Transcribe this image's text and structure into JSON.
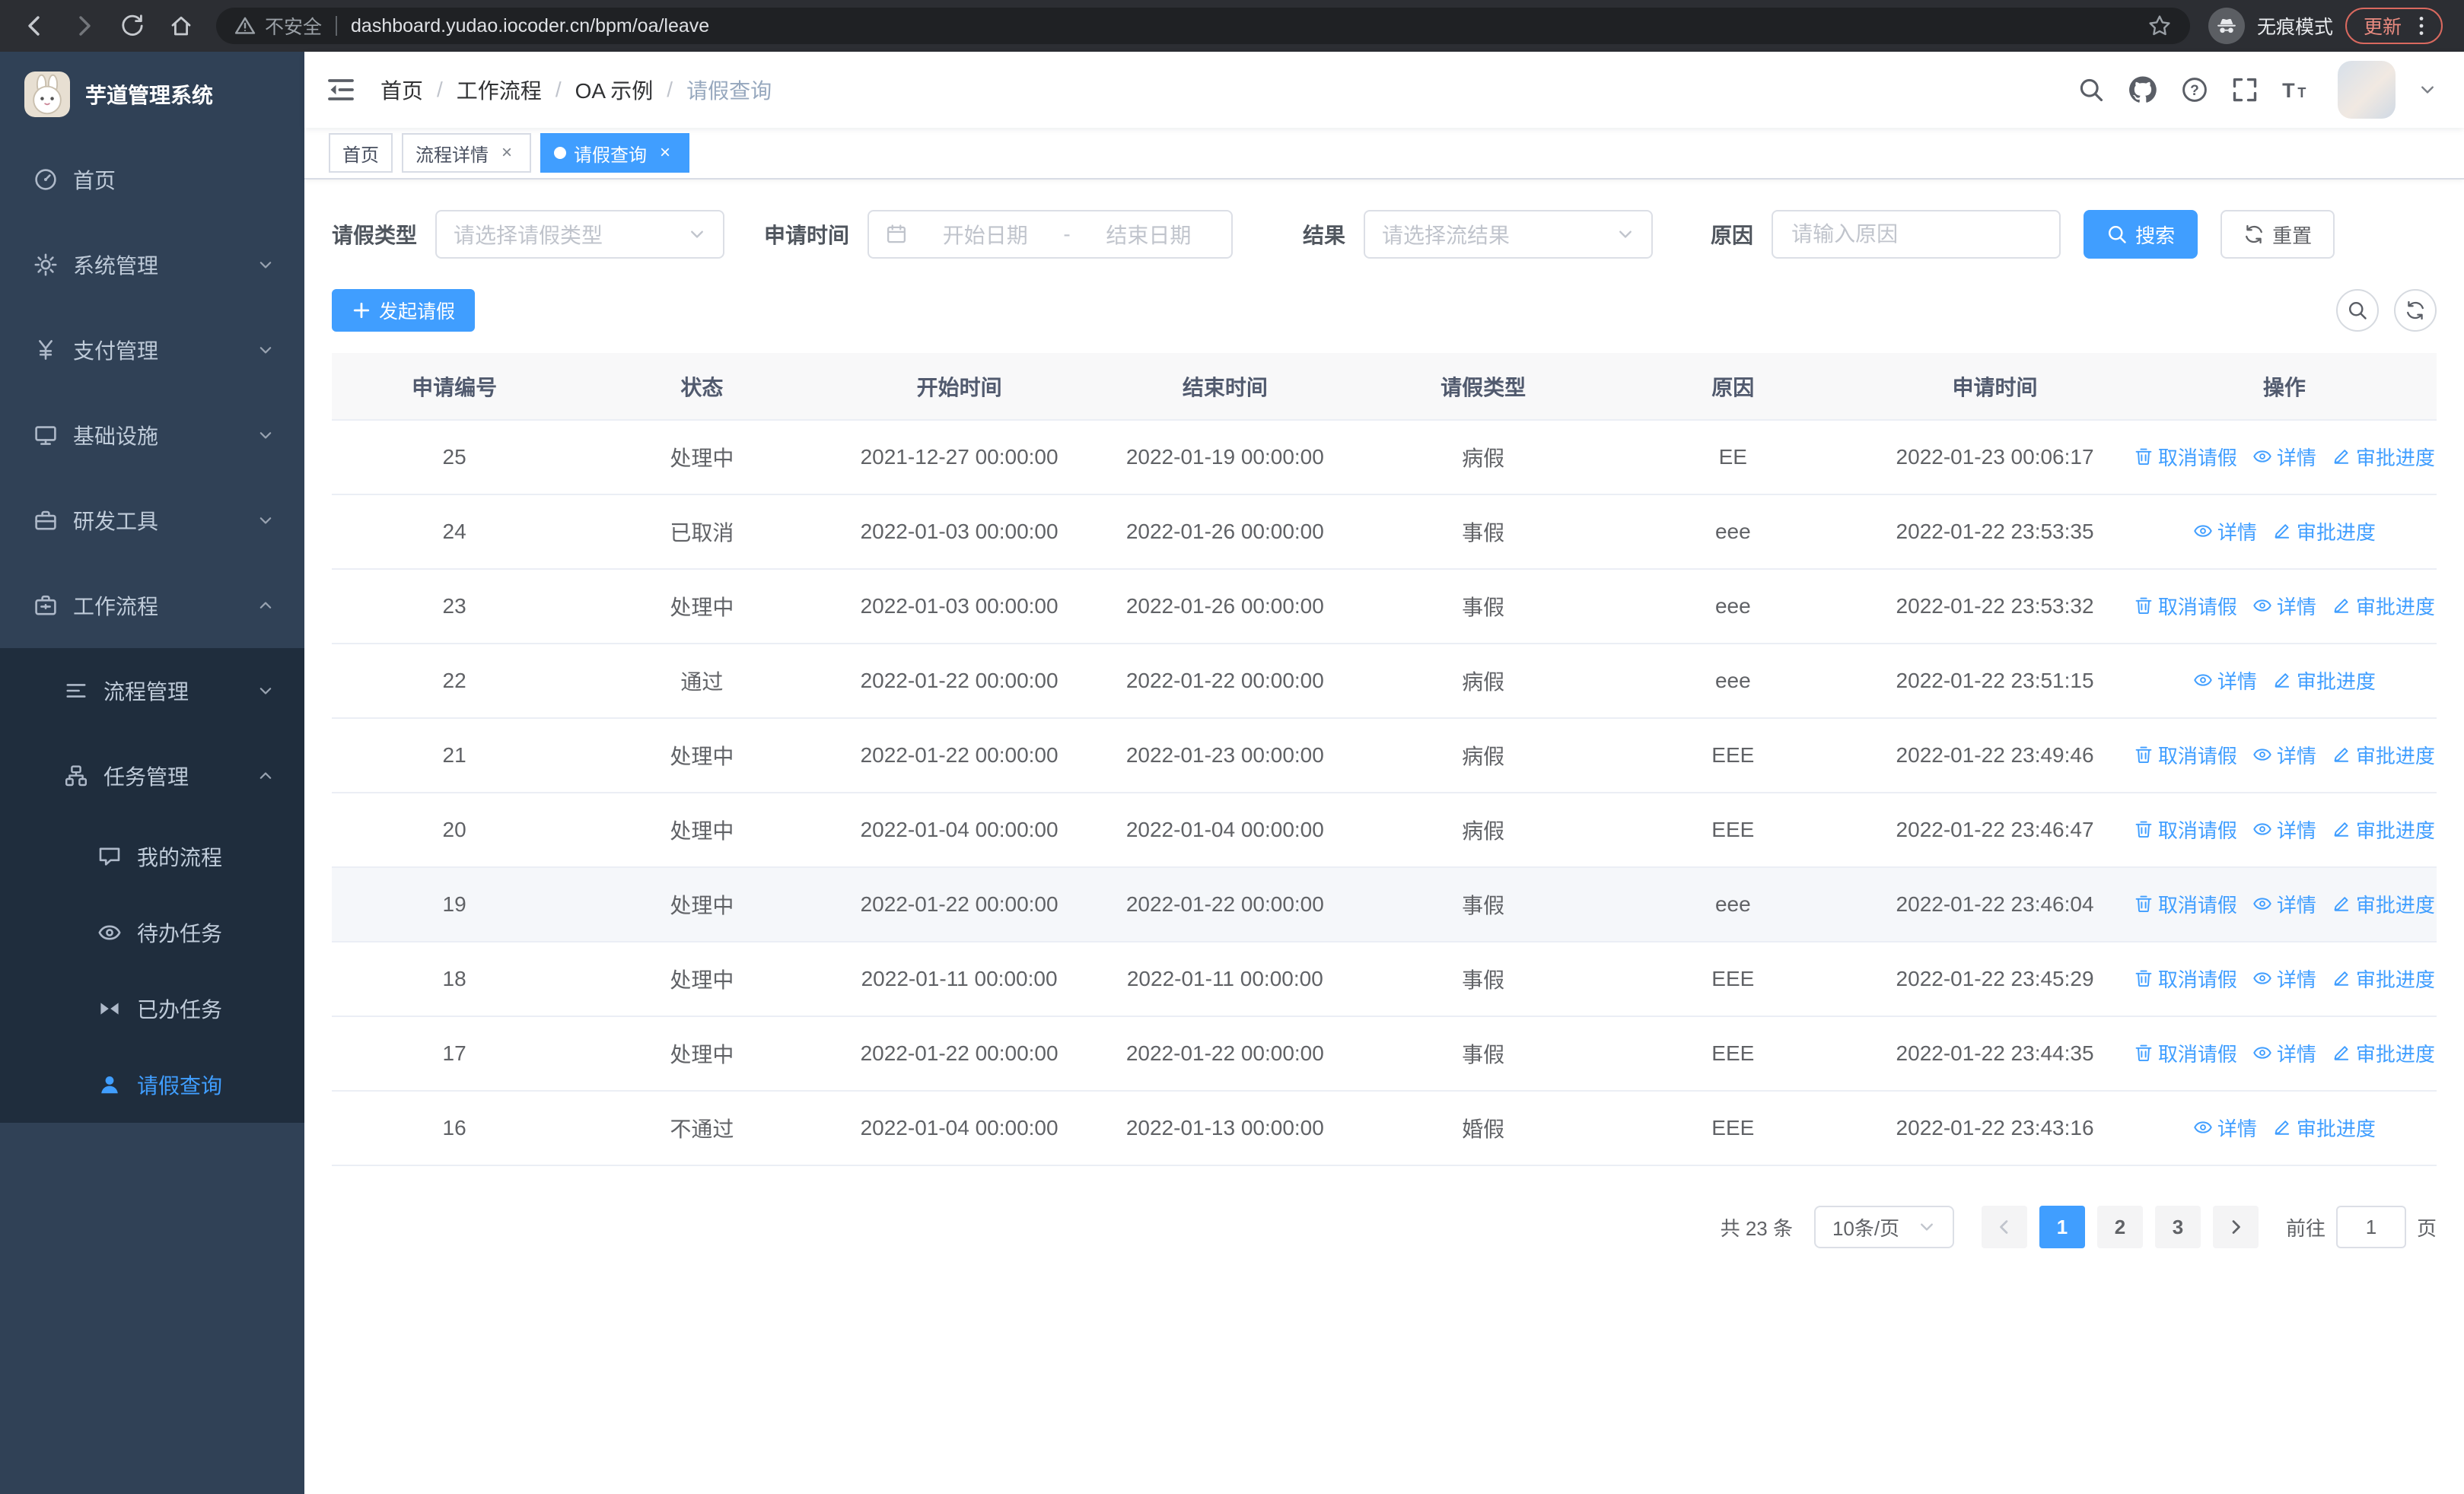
{
  "browser": {
    "security_warning": "不安全",
    "url": "dashboard.yudao.iocoder.cn/bpm/oa/leave",
    "incognito_label": "无痕模式",
    "update_label": "更新"
  },
  "sidebar": {
    "title": "芋道管理系统",
    "menu": [
      {
        "id": "home",
        "label": "首页",
        "icon": "dashboard-icon",
        "type": "top"
      },
      {
        "id": "system",
        "label": "系统管理",
        "icon": "gear-icon",
        "type": "top",
        "arrow": "down"
      },
      {
        "id": "payment",
        "label": "支付管理",
        "icon": "payment-icon",
        "type": "top",
        "arrow": "down"
      },
      {
        "id": "infrastructure",
        "label": "基础设施",
        "icon": "infra-icon",
        "type": "top",
        "arrow": "down"
      },
      {
        "id": "dev-tools",
        "label": "研发工具",
        "icon": "tools-icon",
        "type": "top",
        "arrow": "down"
      },
      {
        "id": "workflow",
        "label": "工作流程",
        "icon": "workflow-icon",
        "type": "top",
        "arrow": "up"
      },
      {
        "id": "process-mgmt",
        "label": "流程管理",
        "icon": "process-icon",
        "type": "sub",
        "arrow": "down"
      },
      {
        "id": "task-mgmt",
        "label": "任务管理",
        "icon": "task-icon",
        "type": "sub",
        "arrow": "up"
      },
      {
        "id": "my-process",
        "label": "我的流程",
        "icon": "chat-icon",
        "type": "leaf"
      },
      {
        "id": "todo-tasks",
        "label": "待办任务",
        "icon": "eye-icon",
        "type": "leaf"
      },
      {
        "id": "done-tasks",
        "label": "已办任务",
        "icon": "done-icon",
        "type": "leaf"
      },
      {
        "id": "leave-query",
        "label": "请假查询",
        "icon": "user-icon",
        "type": "leaf",
        "active": true
      }
    ]
  },
  "navbar": {
    "breadcrumb": [
      "首页",
      "工作流程",
      "OA 示例",
      "请假查询"
    ]
  },
  "tags": [
    {
      "label": "首页",
      "active": false,
      "closable": false
    },
    {
      "label": "流程详情",
      "active": false,
      "closable": true
    },
    {
      "label": "请假查询",
      "active": true,
      "closable": true
    }
  ],
  "filters": {
    "leave_type_label": "请假类型",
    "leave_type_placeholder": "请选择请假类型",
    "apply_time_label": "申请时间",
    "start_date_placeholder": "开始日期",
    "range_separator": "-",
    "end_date_placeholder": "结束日期",
    "result_label": "结果",
    "result_placeholder": "请选择流结果",
    "reason_label": "原因",
    "reason_placeholder": "请输入原因",
    "search_button": "搜索",
    "reset_button": "重置"
  },
  "toolbar": {
    "create_button": "发起请假"
  },
  "table": {
    "columns": [
      "申请编号",
      "状态",
      "开始时间",
      "结束时间",
      "请假类型",
      "原因",
      "申请时间",
      "操作"
    ],
    "column_keys": [
      "id",
      "status",
      "start",
      "end",
      "type",
      "reason",
      "applied",
      "ops"
    ],
    "action_defs": {
      "cancel": {
        "label": "取消请假",
        "icon": "delete-icon"
      },
      "detail": {
        "label": "详情",
        "icon": "view-icon"
      },
      "progress": {
        "label": "审批进度",
        "icon": "edit-icon"
      }
    },
    "rows": [
      {
        "id": "25",
        "status": "处理中",
        "start": "2021-12-27 00:00:00",
        "end": "2022-01-19 00:00:00",
        "type": "病假",
        "reason": "EE",
        "applied": "2022-01-23 00:06:17",
        "actions": [
          "cancel",
          "detail",
          "progress"
        ]
      },
      {
        "id": "24",
        "status": "已取消",
        "start": "2022-01-03 00:00:00",
        "end": "2022-01-26 00:00:00",
        "type": "事假",
        "reason": "eee",
        "applied": "2022-01-22 23:53:35",
        "actions": [
          "detail",
          "progress"
        ]
      },
      {
        "id": "23",
        "status": "处理中",
        "start": "2022-01-03 00:00:00",
        "end": "2022-01-26 00:00:00",
        "type": "事假",
        "reason": "eee",
        "applied": "2022-01-22 23:53:32",
        "actions": [
          "cancel",
          "detail",
          "progress"
        ]
      },
      {
        "id": "22",
        "status": "通过",
        "start": "2022-01-22 00:00:00",
        "end": "2022-01-22 00:00:00",
        "type": "病假",
        "reason": "eee",
        "applied": "2022-01-22 23:51:15",
        "actions": [
          "detail",
          "progress"
        ]
      },
      {
        "id": "21",
        "status": "处理中",
        "start": "2022-01-22 00:00:00",
        "end": "2022-01-23 00:00:00",
        "type": "病假",
        "reason": "EEE",
        "applied": "2022-01-22 23:49:46",
        "actions": [
          "cancel",
          "detail",
          "progress"
        ]
      },
      {
        "id": "20",
        "status": "处理中",
        "start": "2022-01-04 00:00:00",
        "end": "2022-01-04 00:00:00",
        "type": "病假",
        "reason": "EEE",
        "applied": "2022-01-22 23:46:47",
        "actions": [
          "cancel",
          "detail",
          "progress"
        ]
      },
      {
        "id": "19",
        "status": "处理中",
        "start": "2022-01-22 00:00:00",
        "end": "2022-01-22 00:00:00",
        "type": "事假",
        "reason": "eee",
        "applied": "2022-01-22 23:46:04",
        "actions": [
          "cancel",
          "detail",
          "progress"
        ],
        "highlighted": true
      },
      {
        "id": "18",
        "status": "处理中",
        "start": "2022-01-11 00:00:00",
        "end": "2022-01-11 00:00:00",
        "type": "事假",
        "reason": "EEE",
        "applied": "2022-01-22 23:45:29",
        "actions": [
          "cancel",
          "detail",
          "progress"
        ]
      },
      {
        "id": "17",
        "status": "处理中",
        "start": "2022-01-22 00:00:00",
        "end": "2022-01-22 00:00:00",
        "type": "事假",
        "reason": "EEE",
        "applied": "2022-01-22 23:44:35",
        "actions": [
          "cancel",
          "detail",
          "progress"
        ]
      },
      {
        "id": "16",
        "status": "不通过",
        "start": "2022-01-04 00:00:00",
        "end": "2022-01-13 00:00:00",
        "type": "婚假",
        "reason": "EEE",
        "applied": "2022-01-22 23:43:16",
        "actions": [
          "detail",
          "progress"
        ]
      }
    ]
  },
  "pagination": {
    "total_text": "共 23 条",
    "page_size": "10条/页",
    "pages": [
      "1",
      "2",
      "3"
    ],
    "active_page": "1",
    "goto_label": "前往",
    "goto_value": "1",
    "goto_suffix": "页"
  },
  "colors": {
    "primary": "#409eff",
    "sidebar_bg": "#304156",
    "submenu_bg": "#1f2d3d"
  }
}
